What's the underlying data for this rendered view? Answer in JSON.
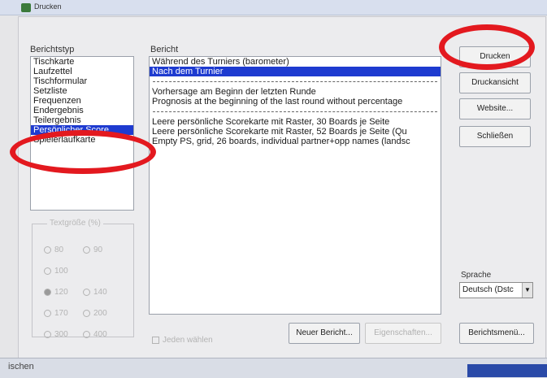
{
  "window": {
    "title": "Drucken",
    "close_glyph": "×"
  },
  "report_type": {
    "label": "Berichtstyp",
    "items": [
      "Tischkarte",
      "Laufzettel",
      "Tischformular",
      "Setzliste",
      "Frequenzen",
      "Endergebnis",
      "Teilergebnis",
      "Persönlicher Score",
      "Spielerlaufkarte"
    ],
    "selected_index": 7
  },
  "report": {
    "label": "Bericht",
    "groups": [
      [
        "Während des Turniers (barometer)",
        "Nach dem Turnier"
      ],
      [
        "Vorhersage am Beginn der letzten Runde",
        "Prognosis at the beginning of the last round without percentage"
      ],
      [
        "Leere persönliche Scorekarte mit Raster, 30 Boards je Seite",
        "Leere persönliche Scorekarte mit Raster, 52 Boards je Seite (Qu",
        "Empty PS, grid, 26 boards, individual partner+opp names (landsc"
      ]
    ],
    "selected": "Nach dem Turnier"
  },
  "font_size": {
    "legend": "Textgröße (%)",
    "options": [
      "80",
      "90",
      "100",
      "120",
      "140",
      "170",
      "200",
      "300",
      "400"
    ],
    "selected": "120"
  },
  "checkbox_label": "Jeden wählen",
  "buttons": {
    "print": "Drucken",
    "preview": "Druckansicht",
    "website": "Website...",
    "close": "Schließen",
    "new_report": "Neuer Bericht...",
    "properties": "Eigenschaften...",
    "report_menu": "Berichtsmenü..."
  },
  "language": {
    "label": "Sprache",
    "value": "Deutsch (Dstc"
  },
  "status": {
    "text": "ischen"
  },
  "colors": {
    "selection": "#1e3bd0",
    "annotation_ring": "#e3191f"
  }
}
